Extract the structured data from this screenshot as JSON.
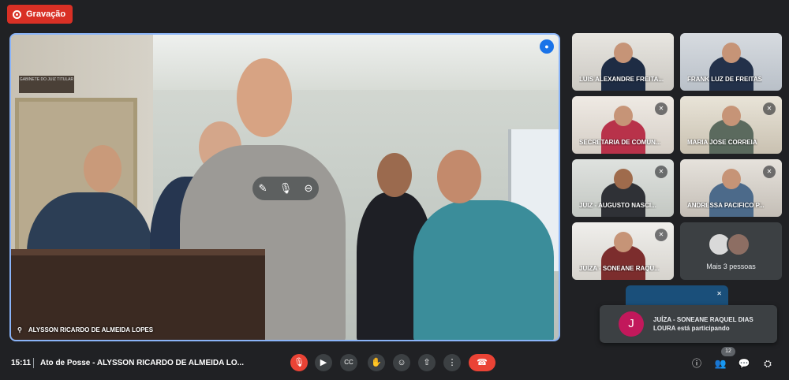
{
  "recording": {
    "label": "Gravação"
  },
  "main_video": {
    "speaker_name": "ALYSSON RICARDO DE ALMEIDA LOPES",
    "plaque_text": "GABINETE DO JUIZ TITULAR"
  },
  "tiles": [
    {
      "name": "LUIS ALEXANDRE FREITA...",
      "muted": false
    },
    {
      "name": "FRANK LUZ DE FREITAS",
      "muted": false
    },
    {
      "name": "SECRETARIA DE COMUN...",
      "muted": true
    },
    {
      "name": "MARIA JOSE CORREIA",
      "muted": true
    },
    {
      "name": "JUIZ - AUGUSTO NASCI...",
      "muted": true
    },
    {
      "name": "ANDRESSA PACIFICO P...",
      "muted": true
    },
    {
      "name": "JUÍZA - SONEANE RAQU...",
      "muted": true
    }
  ],
  "more_people": {
    "label": "Mais 3 pessoas"
  },
  "notification": {
    "avatar_letter": "J",
    "text": "JUÍZA - SONEANE RAQUEL DIAS LOURA está participando"
  },
  "bottom_bar": {
    "time": "15:11",
    "meeting_title": "Ato de Posse - ALYSSON RICARDO DE ALMEIDA LO...",
    "participant_count": "12"
  }
}
